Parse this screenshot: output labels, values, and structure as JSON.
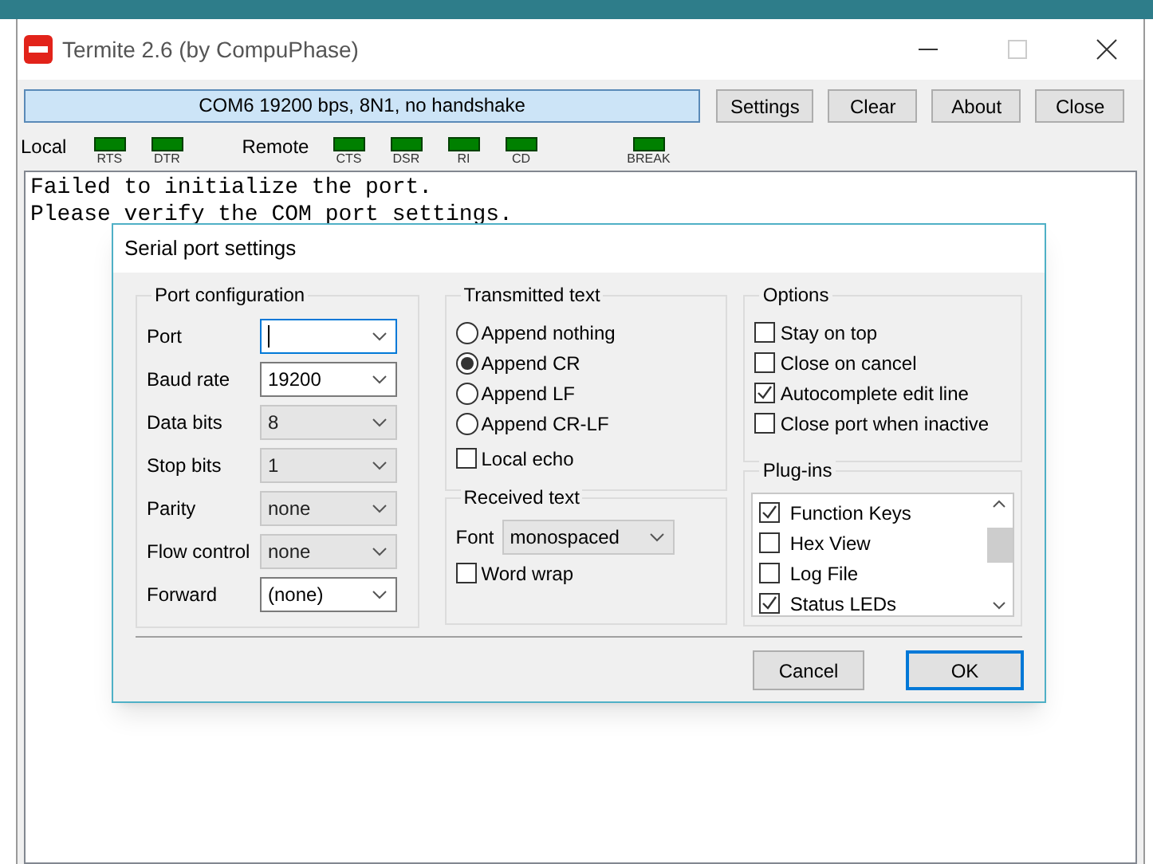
{
  "window": {
    "title": "Termite 2.6 (by CompuPhase)"
  },
  "status_field": "COM6 19200 bps, 8N1, no handshake",
  "toolbar_buttons": [
    "Settings",
    "Clear",
    "About",
    "Close"
  ],
  "leds": {
    "local_label": "Local",
    "local": [
      "RTS",
      "DTR"
    ],
    "remote_label": "Remote",
    "remote": [
      "CTS",
      "DSR",
      "RI",
      "CD"
    ],
    "break": "BREAK"
  },
  "terminal_lines": [
    "Failed to initialize the port.",
    "Please verify the COM port settings."
  ],
  "dialog": {
    "title": "Serial port settings",
    "port_configuration": {
      "title": "Port configuration",
      "fields": [
        {
          "label": "Port",
          "disabled": false,
          "focused": true
        },
        {
          "label": "Baud rate",
          "value": "19200",
          "disabled": false,
          "focused": false
        },
        {
          "label": "Data bits",
          "value": "8",
          "disabled": true,
          "focused": false
        },
        {
          "label": "Stop bits",
          "value": "1",
          "disabled": true,
          "focused": false
        },
        {
          "label": "Parity",
          "value": "none",
          "disabled": true,
          "focused": false
        },
        {
          "label": "Flow control",
          "value": "none",
          "disabled": true,
          "focused": false
        },
        {
          "label": "Forward",
          "value": "(none)",
          "disabled": false,
          "focused": false
        }
      ]
    },
    "transmitted_text": {
      "title": "Transmitted text",
      "options": [
        {
          "label": "Append nothing",
          "selected": false
        },
        {
          "label": "Append CR",
          "selected": true
        },
        {
          "label": "Append LF",
          "selected": false
        },
        {
          "label": "Append CR-LF",
          "selected": false
        }
      ],
      "local_echo": {
        "label": "Local echo",
        "checked": false
      }
    },
    "received_text": {
      "title": "Received text",
      "font_label": "Font",
      "font_value": "monospaced",
      "word_wrap": {
        "label": "Word wrap",
        "checked": false
      }
    },
    "options": {
      "title": "Options",
      "items": [
        {
          "label": "Stay on top",
          "checked": false
        },
        {
          "label": "Close on cancel",
          "checked": false
        },
        {
          "label": "Autocomplete edit line",
          "checked": true
        },
        {
          "label": "Close port when inactive",
          "checked": false
        }
      ]
    },
    "plugins": {
      "title": "Plug-ins",
      "items": [
        {
          "label": "Function Keys",
          "checked": true
        },
        {
          "label": "Hex View",
          "checked": false
        },
        {
          "label": "Log File",
          "checked": false
        },
        {
          "label": "Status LEDs",
          "checked": true
        }
      ]
    },
    "buttons": [
      {
        "label": "Cancel",
        "default": false
      },
      {
        "label": "OK",
        "default": true
      }
    ]
  }
}
